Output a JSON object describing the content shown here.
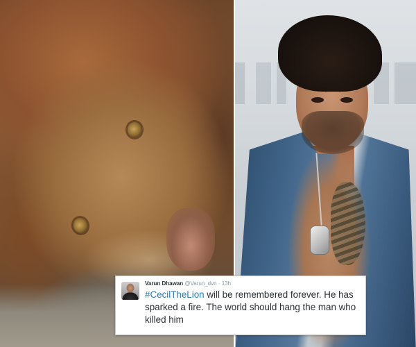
{
  "tweet": {
    "display_name": "Varun Dhawan",
    "handle": "@Varun_dvn",
    "separator": "·",
    "time": "13h",
    "hashtag": "#CecilTheLion",
    "text_after_hashtag": " will be remembered forever. He has sparked a fire. The world should hang the man who killed him",
    "hashtag_color": "#2b7bb9"
  },
  "images": {
    "left": "lion-photo",
    "right": "man-photo"
  }
}
